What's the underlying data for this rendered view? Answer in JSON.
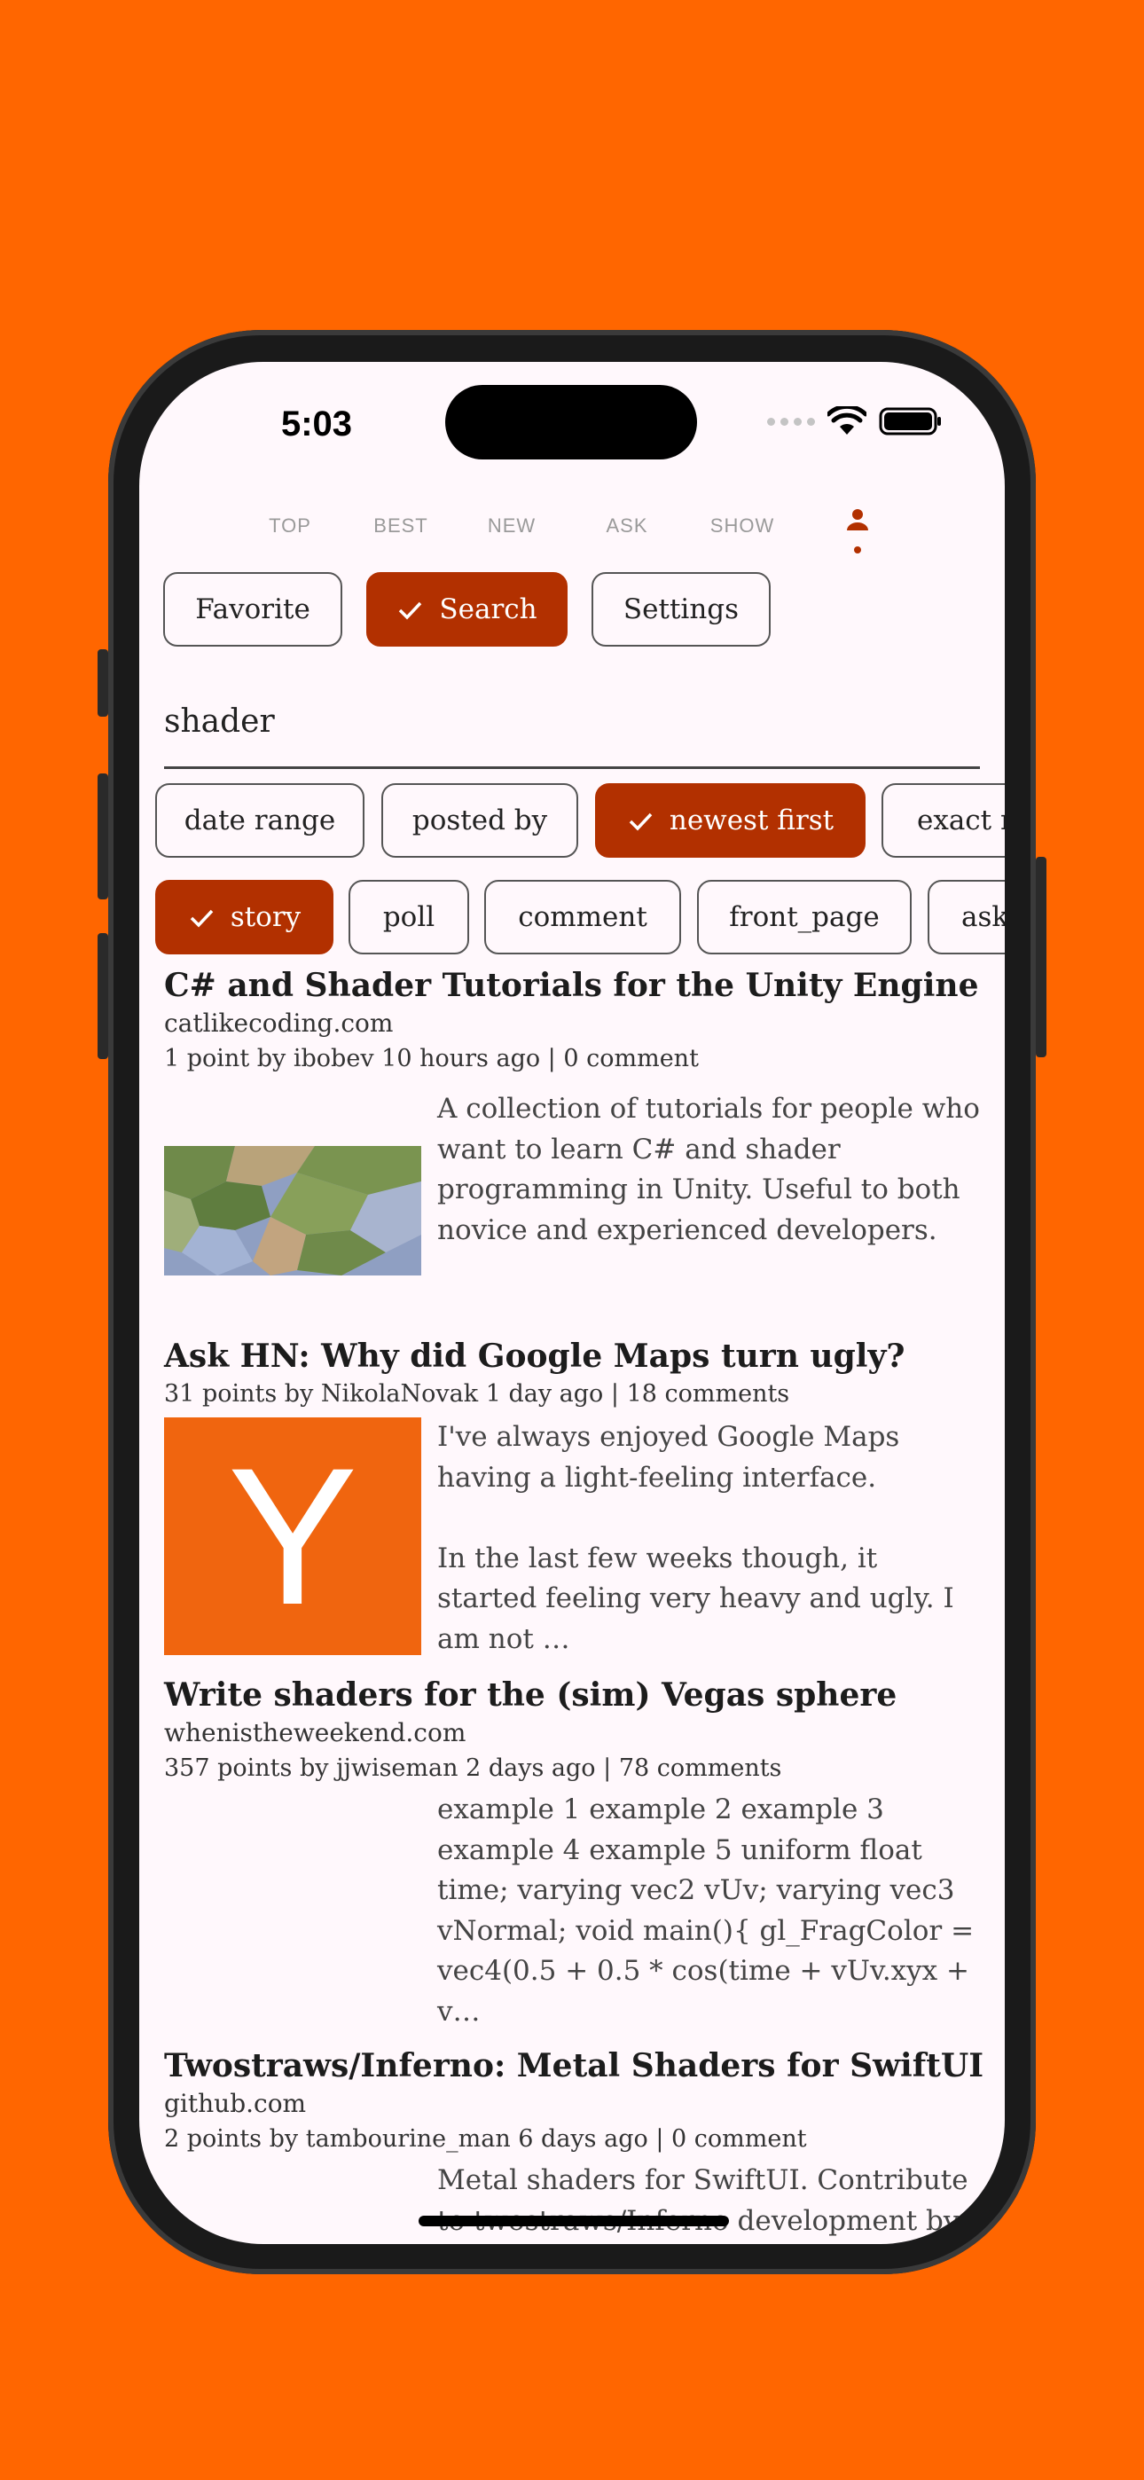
{
  "status": {
    "time": "5:03"
  },
  "nav": {
    "top": "TOP",
    "best": "BEST",
    "new": "NEW",
    "ask": "ASK",
    "show": "SHOW"
  },
  "actions": {
    "favorite": "Favorite",
    "search": "Search",
    "settings": "Settings"
  },
  "search": {
    "query": "shader"
  },
  "filters": [
    "date range",
    "posted by",
    "newest first",
    "exact match"
  ],
  "tags": [
    "story",
    "poll",
    "comment",
    "front_page",
    "ask_hn"
  ],
  "stories": [
    {
      "title": "C# and Shader Tutorials for the Unity Engine",
      "domain": "catlikecoding.com",
      "meta": "1 point by ibobev 10 hours ago | 0 comment",
      "desc": "A collection of tutorials for people who want to learn C# and shader programming in Unity. Useful to both novice and experienced developers."
    },
    {
      "title": "Ask HN: Why did Google Maps turn ugly?",
      "domain": "",
      "meta": "31 points by NikolaNovak 1 day ago | 18 comments",
      "desc": "I've always enjoyed Google Maps having a light-feeling interface.\n\nIn the last few weeks though, it started feeling very heavy and ugly. I am not …",
      "thumb_letter": "Y"
    },
    {
      "title": "Write shaders for the (sim) Vegas sphere",
      "domain": "whenistheweekend.com",
      "meta": "357 points by jjwiseman 2 days ago | 78 comments",
      "desc": "example 1 example 2 example 3 example 4 example 5 uniform float time; varying vec2 vUv; varying vec3 vNormal; void main(){ gl_FragColor = vec4(0.5 + 0.5 * cos(time + vUv.xyx + v…"
    },
    {
      "title": "Twostraws/Inferno: Metal Shaders for SwiftUI",
      "domain": "github.com",
      "meta": "2 points by tambourine_man 6 days ago | 0 comment",
      "desc": "Metal shaders for SwiftUI. Contribute to twostraws/Inferno development by"
    }
  ],
  "colors": {
    "background": "#FF6600",
    "accent": "#B23000",
    "surface": "#FFF8FC"
  },
  "icons": [
    "wifi-icon",
    "battery-icon",
    "check-icon",
    "profile-icon"
  ]
}
